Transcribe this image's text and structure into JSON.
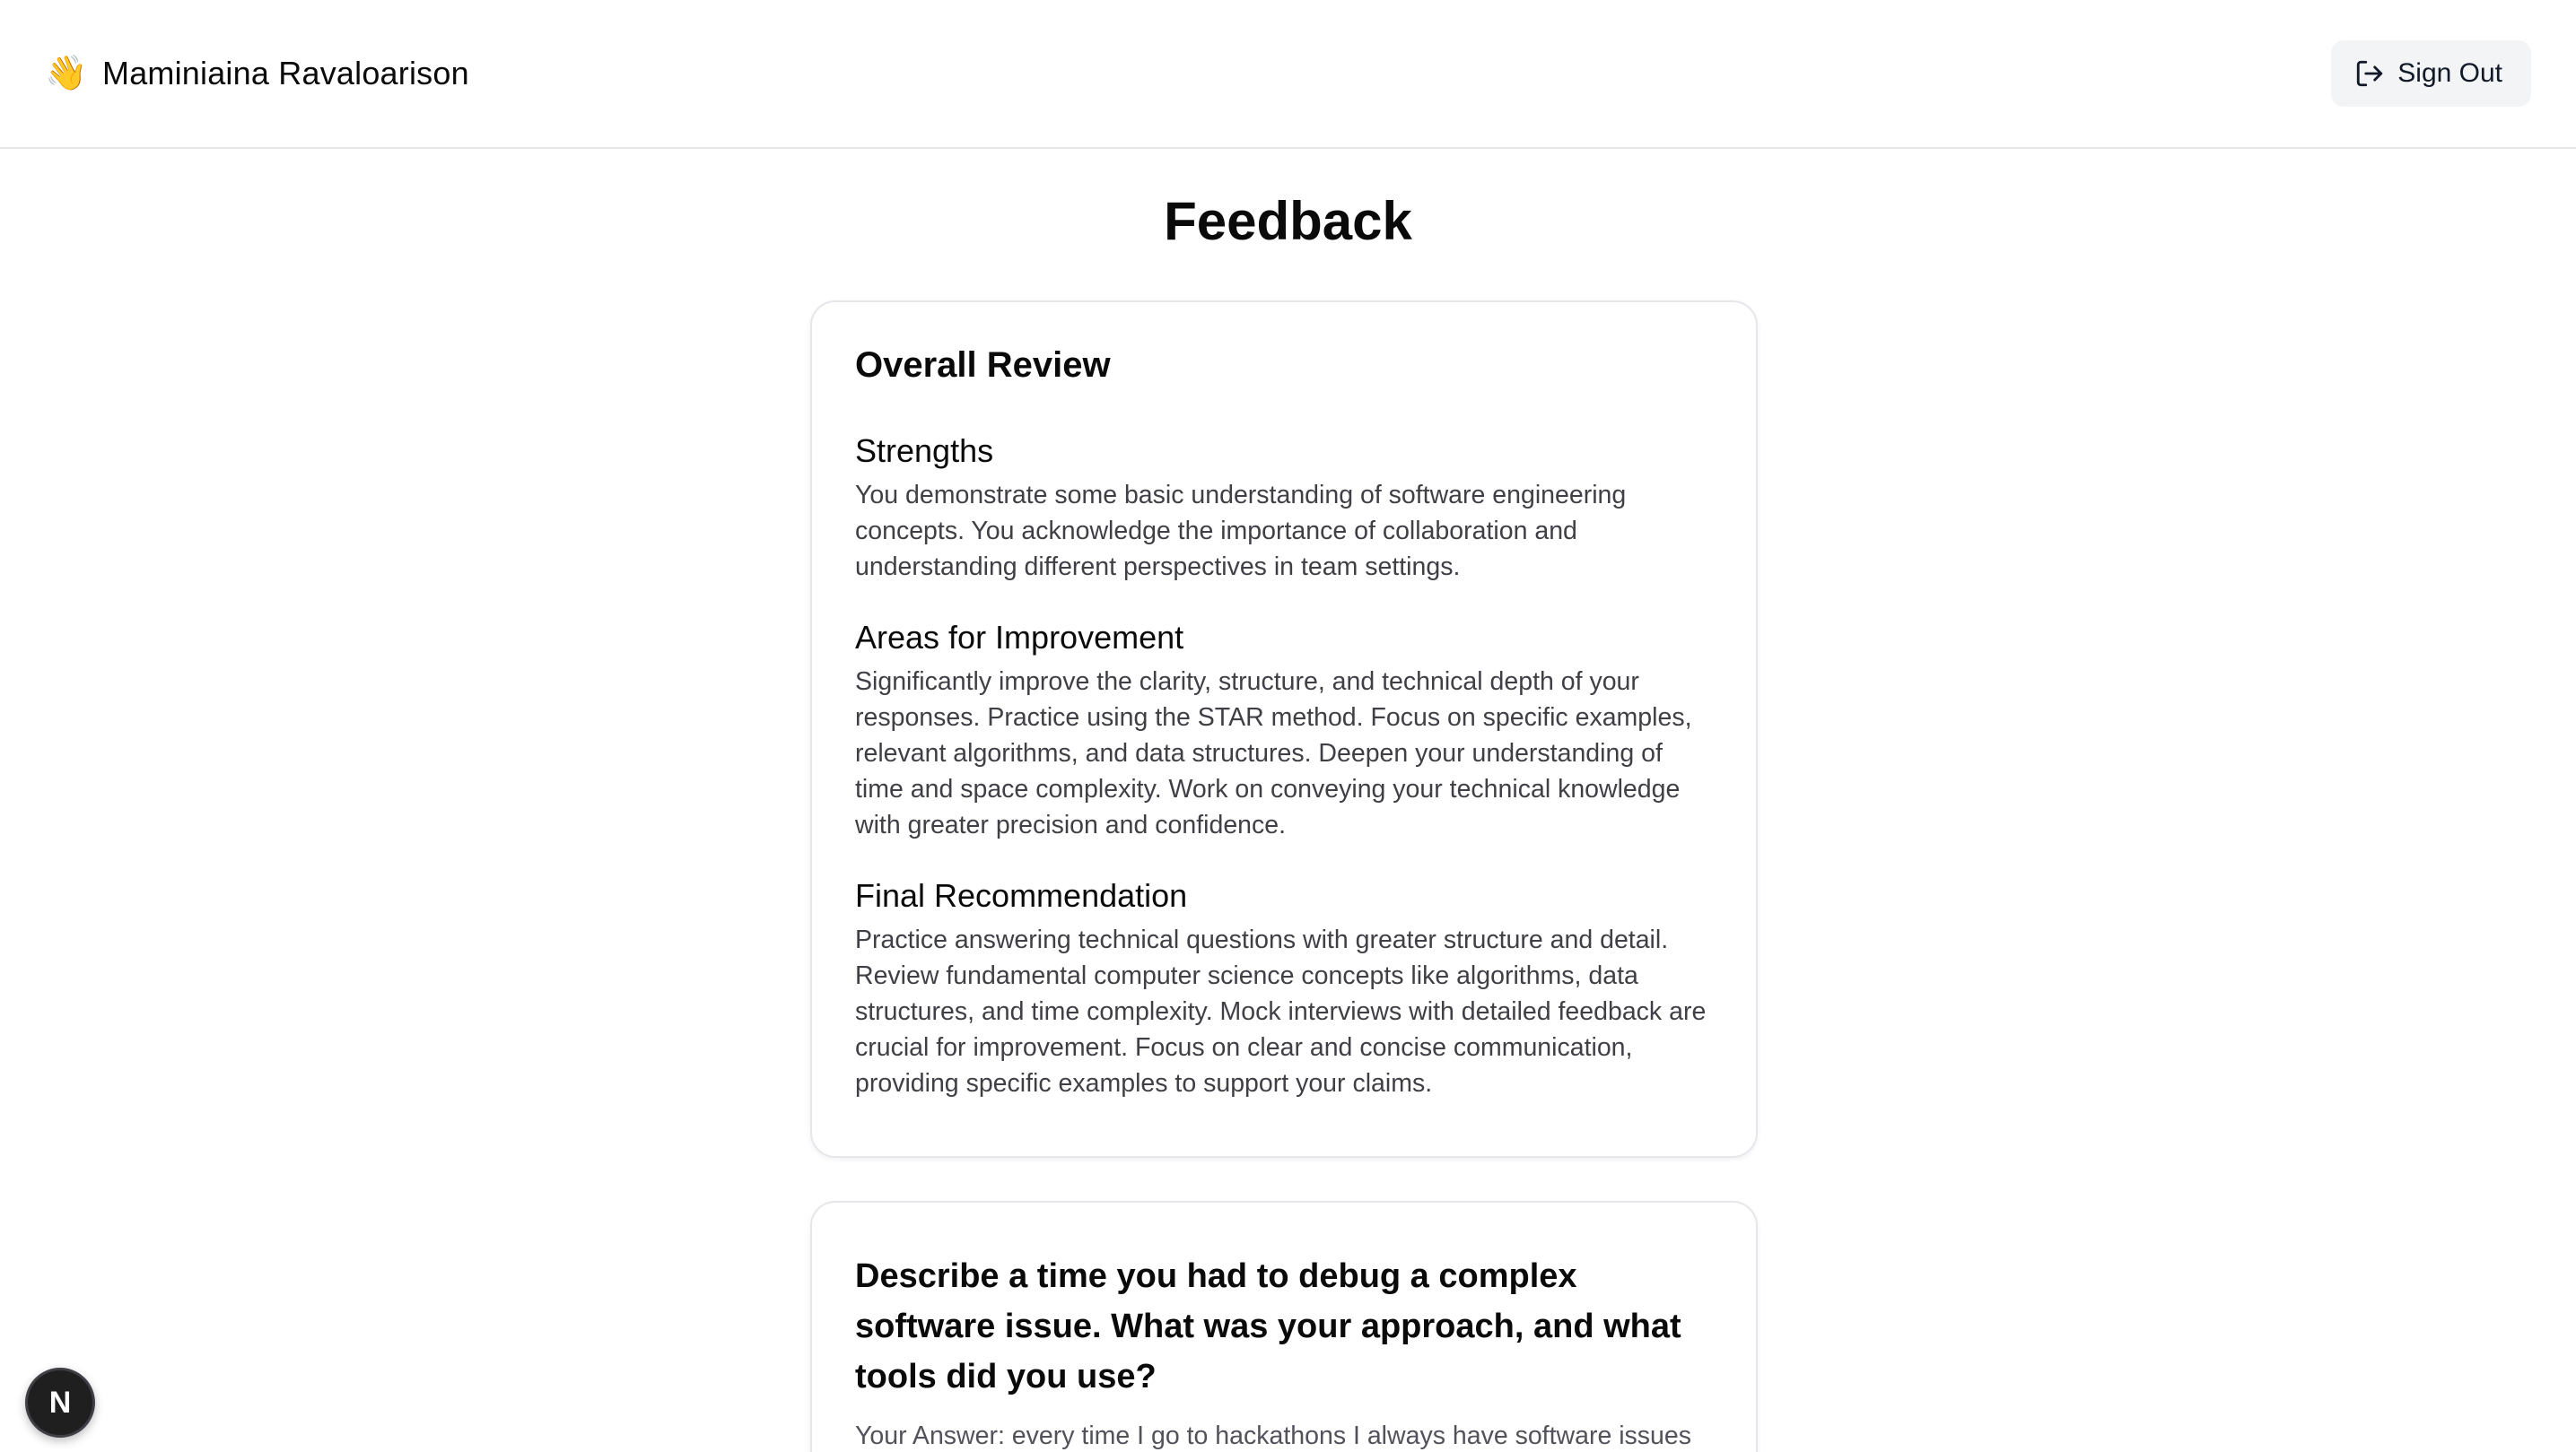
{
  "header": {
    "wave_emoji": "👋",
    "user_name": "Maminiaina Ravaloarison",
    "sign_out_label": "Sign Out"
  },
  "page": {
    "title": "Feedback"
  },
  "overall_review": {
    "heading": "Overall Review",
    "sections": [
      {
        "title": "Strengths",
        "text": "You demonstrate some basic understanding of software engineering concepts. You acknowledge the importance of collaboration and understanding different perspectives in team settings."
      },
      {
        "title": "Areas for Improvement",
        "text": "Significantly improve the clarity, structure, and technical depth of your responses. Practice using the STAR method. Focus on specific examples, relevant algorithms, and data structures. Deepen your understanding of time and space complexity. Work on conveying your technical knowledge with greater precision and confidence."
      },
      {
        "title": "Final Recommendation",
        "text": "Practice answering technical questions with greater structure and detail. Review fundamental computer science concepts like algorithms, data structures, and time complexity. Mock interviews with detailed feedback are crucial for improvement. Focus on clear and concise communication, providing specific examples to support your claims."
      }
    ]
  },
  "question_card": {
    "question": "Describe a time you had to debug a complex software issue. What was your approach, and what tools did you use?",
    "answer": "Your Answer: every time I go to hackathons I always have software issues"
  },
  "dev_badge": {
    "label": "N"
  },
  "colors": {
    "header_border": "#e5e7eb",
    "card_border": "#e5e7eb",
    "button_bg": "#f3f4f6",
    "body_text": "#3f3f46",
    "badge_bg": "#1f1f1f"
  }
}
